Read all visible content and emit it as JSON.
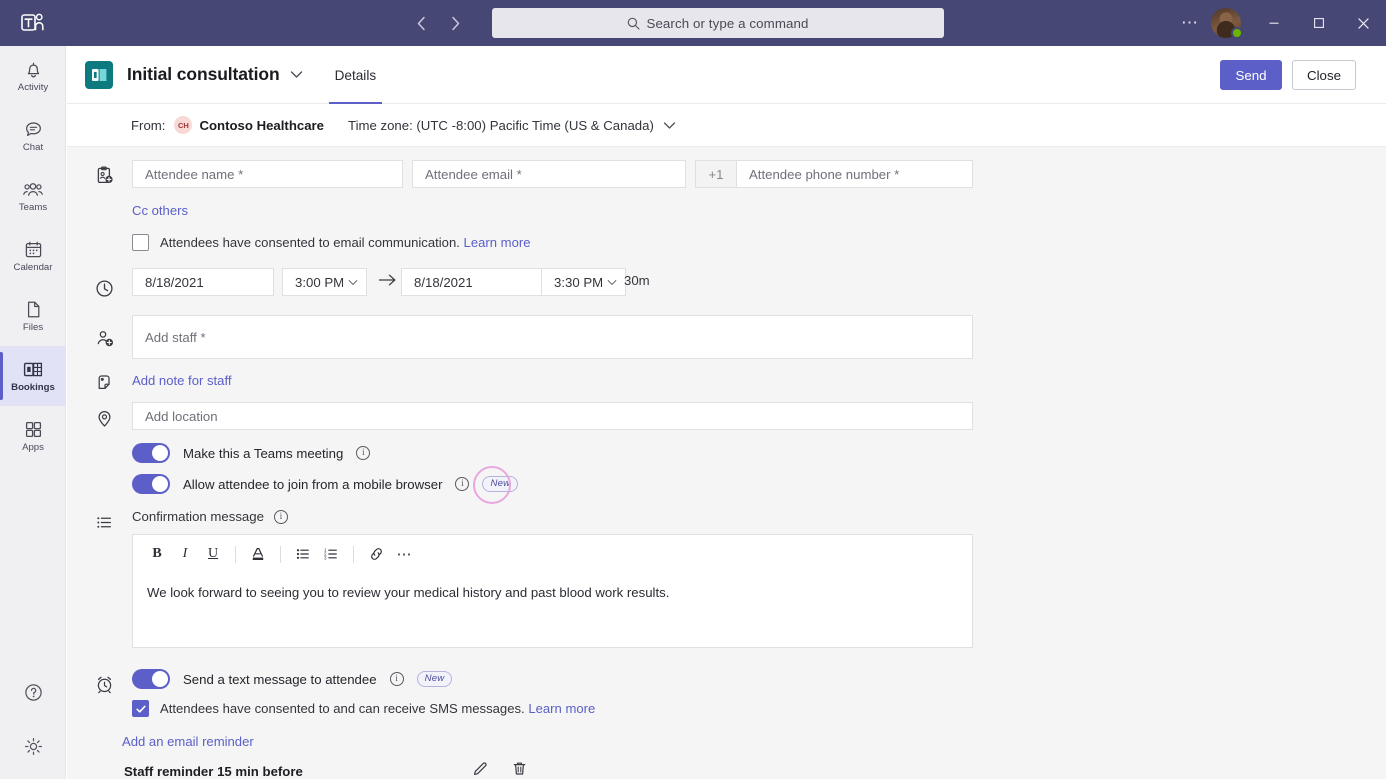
{
  "titlebar": {
    "logo_icon": "teams-logo-icon",
    "back_icon": "chevron-left-icon",
    "forward_icon": "chevron-right-icon",
    "search": {
      "placeholder": "Search or type a command",
      "icon": "search-icon"
    },
    "more_icon": "ellipsis-icon",
    "avatar": "user-avatar",
    "presence": "available-presence",
    "minimize_icon": "minimize-icon",
    "maximize_icon": "maximize-icon",
    "close_icon": "close-icon",
    "bg": "#464775"
  },
  "sidebar": {
    "items": [
      {
        "label": "Activity",
        "icon": "bell-icon",
        "active": false
      },
      {
        "label": "Chat",
        "icon": "chat-icon",
        "active": false
      },
      {
        "label": "Teams",
        "icon": "people-icon",
        "active": false
      },
      {
        "label": "Calendar",
        "icon": "calendar-icon",
        "active": false
      },
      {
        "label": "Files",
        "icon": "file-icon",
        "active": false
      },
      {
        "label": "Bookings",
        "icon": "bookings-icon",
        "active": true
      },
      {
        "label": "Apps",
        "icon": "apps-grid-icon",
        "active": false
      }
    ],
    "bottom": [
      {
        "name": "help-icon"
      },
      {
        "name": "settings-gear-icon"
      }
    ],
    "accent": "#5b5fc7"
  },
  "header": {
    "service_icon": "bookings-service-icon",
    "title": "Initial consultation",
    "title_chevron": "chevron-down-icon",
    "tabs": [
      {
        "label": "Details",
        "active": true
      }
    ],
    "send_label": "Send",
    "close_label": "Close",
    "primary_color": "#5b5fc7"
  },
  "subheader": {
    "from_label": "From:",
    "org_initials": "CH",
    "org_name": "Contoso Healthcare",
    "timezone": "Time zone: (UTC -8:00) Pacific Time (US & Canada)",
    "timezone_chevron": "chevron-down-icon"
  },
  "form": {
    "attendee": {
      "icon": "attendee-card-icon",
      "name_placeholder": "Attendee name *",
      "email_placeholder": "Attendee email *",
      "phone_prefix": "+1",
      "phone_placeholder": "Attendee phone number *",
      "cc_link": "Cc others",
      "consent_text": "Attendees have consented to email communication.",
      "consent_link": "Learn more",
      "consent_checked": false
    },
    "schedule": {
      "icon": "clock-icon",
      "start_date": "8/18/2021",
      "start_time": "3:00 PM",
      "arrow_icon": "arrow-right-icon",
      "end_date": "8/18/2021",
      "end_time": "3:30 PM",
      "duration": "30m",
      "time_chevron": "chevron-down-icon"
    },
    "staff": {
      "icon": "add-staff-icon",
      "placeholder": "Add staff *",
      "note_link": "Add note for staff",
      "note_icon": "note-icon"
    },
    "location": {
      "icon": "location-pin-icon",
      "placeholder": "Add location"
    },
    "toggles": [
      {
        "label": "Make this a Teams meeting",
        "on": true,
        "info_icon": "info-icon",
        "badge": null,
        "highlighted": false
      },
      {
        "label": "Allow attendee to join from a mobile browser",
        "on": true,
        "info_icon": "info-icon",
        "badge": "New",
        "highlighted": true
      }
    ],
    "confirmation": {
      "icon": "list-icon",
      "label": "Confirmation message",
      "info_icon": "info-icon",
      "toolbar": [
        {
          "name": "bold-icon",
          "glyph": "B"
        },
        {
          "name": "italic-icon",
          "glyph": "I"
        },
        {
          "name": "underline-icon",
          "glyph": "U"
        },
        {
          "name": "font-color-icon",
          "glyph": "A"
        },
        {
          "name": "bulleted-list-icon",
          "glyph": ""
        },
        {
          "name": "numbered-list-icon",
          "glyph": ""
        },
        {
          "name": "link-icon",
          "glyph": ""
        },
        {
          "name": "more-options-icon",
          "glyph": "⋯"
        }
      ],
      "body_text": "We look forward to seeing you to review your medical history and past blood work results."
    },
    "sms": {
      "icon": "alarm-clock-icon",
      "toggle_label": "Send a text message to attendee",
      "toggle_on": true,
      "info_icon": "info-icon",
      "badge": "New",
      "consent_text": "Attendees have consented to and can receive SMS messages.",
      "consent_link": "Learn more",
      "consent_checked": true
    },
    "reminders": {
      "add_email_link": "Add an email reminder",
      "staff_reminder": "Staff reminder 15 min before",
      "edit_icon": "pencil-icon",
      "delete_icon": "trash-icon"
    }
  }
}
